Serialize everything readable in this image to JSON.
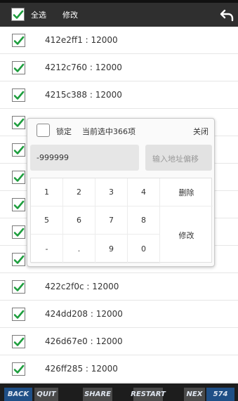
{
  "toolbar": {
    "select_all_label": "全选",
    "modify_label": "修改",
    "undo_icon": "undo-arrow-icon"
  },
  "rows": [
    {
      "text": "412e2ff1 : 12000",
      "checked": true
    },
    {
      "text": "4212c760 : 12000",
      "checked": true
    },
    {
      "text": "4215c388 : 12000",
      "checked": true
    },
    {
      "text": "",
      "checked": true
    },
    {
      "text": "",
      "checked": true
    },
    {
      "text": "",
      "checked": true
    },
    {
      "text": "",
      "checked": true
    },
    {
      "text": "",
      "checked": true
    },
    {
      "text": "",
      "checked": true
    },
    {
      "text": "422c2f0c : 12000",
      "checked": true
    },
    {
      "text": "424dd208 : 12000",
      "checked": true
    },
    {
      "text": "426d67e0 : 12000",
      "checked": true
    },
    {
      "text": "426ff285 : 12000",
      "checked": true
    }
  ],
  "dialog": {
    "lock_label": "锁定",
    "selection_text": "当前选中366项",
    "close_label": "关闭",
    "value": "-999999",
    "offset_placeholder": "输入地址偏移"
  },
  "keypad": {
    "keys": [
      {
        "label": "1"
      },
      {
        "label": "2"
      },
      {
        "label": "3"
      },
      {
        "label": "4"
      },
      {
        "label": "删除"
      },
      {
        "label": "5"
      },
      {
        "label": "6"
      },
      {
        "label": "7"
      },
      {
        "label": "8"
      },
      {
        "label": "修改"
      },
      {
        "label": "-"
      },
      {
        "label": "."
      },
      {
        "label": "9"
      },
      {
        "label": "0"
      }
    ]
  },
  "bottom_bar": {
    "back": "BACK",
    "quit": "QUIT",
    "share": "SHARE",
    "restart": "RESTART",
    "next": "NEX",
    "counter": "574"
  },
  "colors": {
    "accent_check": "#1e9e3e",
    "topbar": "#2f2f2f",
    "bottombar_blue": "#1f4f86"
  }
}
